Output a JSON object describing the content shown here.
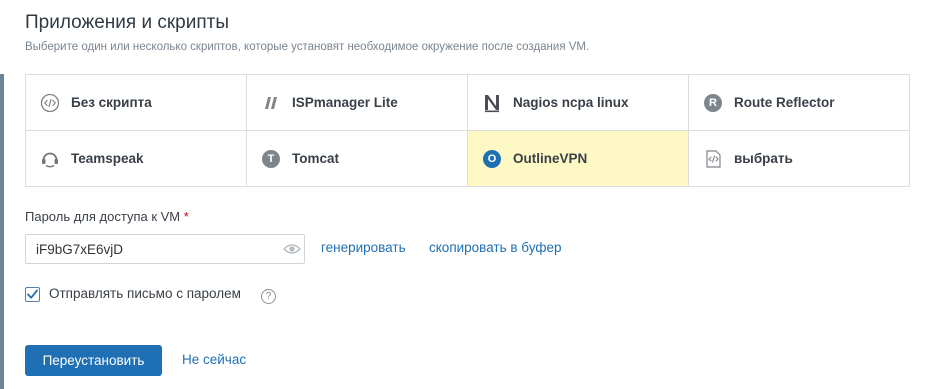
{
  "header": {
    "title": "Приложения и скрипты",
    "subtitle": "Выберите один или несколько скриптов, которые установят необходимое окружение после создания VM."
  },
  "scripts": [
    {
      "label": "Без скрипта",
      "icon": "code-circle-icon",
      "selected": false
    },
    {
      "label": "ISPmanager Lite",
      "icon": "ispmanager-icon",
      "selected": false
    },
    {
      "label": "Nagios ncpa linux",
      "icon": "nagios-icon",
      "selected": false
    },
    {
      "label": "Route Reflector",
      "icon": "letter-r-icon",
      "letter": "R",
      "selected": false
    },
    {
      "label": "Teamspeak",
      "icon": "teamspeak-icon",
      "selected": false
    },
    {
      "label": "Tomcat",
      "icon": "letter-t-icon",
      "letter": "T",
      "selected": false
    },
    {
      "label": "OutlineVPN",
      "icon": "outline-icon",
      "letter": "O",
      "selected": true
    },
    {
      "label": "выбрать",
      "icon": "code-file-icon",
      "selected": false
    }
  ],
  "password": {
    "label": "Пароль для доступа к VM",
    "required_mark": "*",
    "value": "iF9bG7xE6vjD",
    "generate_label": "генерировать",
    "copy_label": "скопировать в буфер"
  },
  "email_option": {
    "label": "Отправлять письмо с паролем",
    "checked": true,
    "help": "?"
  },
  "actions": {
    "primary_label": "Переустановить",
    "secondary_label": "Не сейчас"
  },
  "colors": {
    "accent": "#1f6fb5",
    "selected_bg": "#fdf8c4",
    "border": "#d9dee2"
  }
}
